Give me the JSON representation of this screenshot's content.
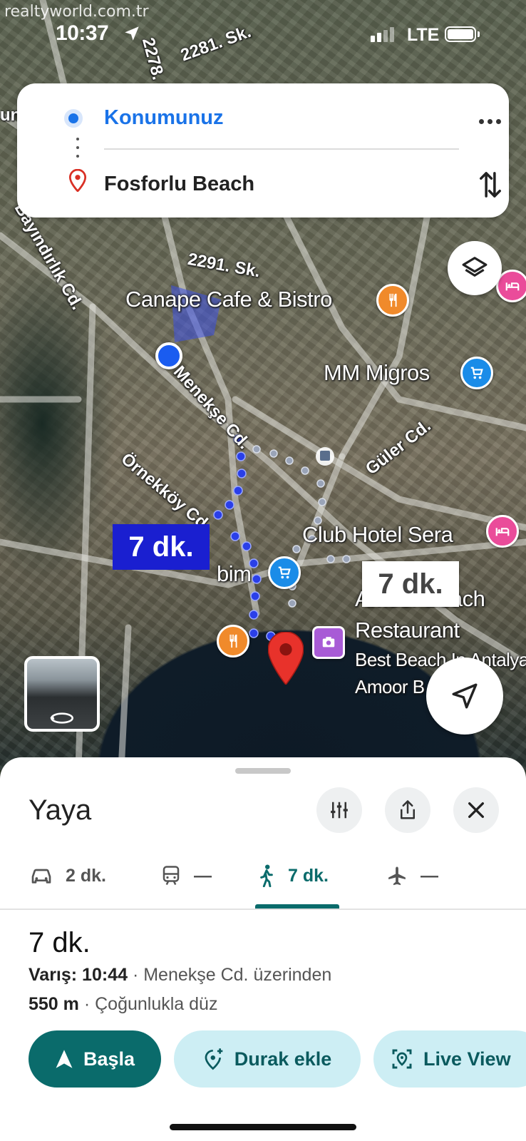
{
  "watermark": "realtyworld.com.tr",
  "status_bar": {
    "time": "10:37",
    "network": "LTE"
  },
  "directions": {
    "origin": "Konumunuz",
    "destination": "Fosforlu Beach"
  },
  "map": {
    "streets": [
      "2278. Sk.",
      "2281. Sk.",
      "2291. Sk.",
      "Bayındırlık Cd.",
      "Menekşe Cd.",
      "Örnekköy Cd.",
      "Güler Cd."
    ],
    "poi": {
      "canape": "Canape Cafe & Bistro",
      "migros": "MM Migros",
      "club_hotel": "Club Hotel Sera",
      "bim": "bim",
      "amoor_title_1": "Amoor Beach",
      "amoor_title_2": "Restaurant",
      "best_beach": "Best Beach In Antalya",
      "amoor_short": "Amoor B"
    },
    "route_time": "7 dk.",
    "alt_route_time": "7 dk.",
    "left_edge_label": "un"
  },
  "sheet": {
    "title": "Yaya",
    "modes": [
      {
        "name": "car",
        "label": "2 dk."
      },
      {
        "name": "transit",
        "label": "—"
      },
      {
        "name": "walk",
        "label": "7 dk.",
        "active": true
      },
      {
        "name": "flight",
        "label": "—"
      }
    ],
    "duration": "7 dk.",
    "arrival_label": "Varış: 10:44",
    "arrival_via": " · Menekşe Cd. üzerinden",
    "distance_label": "550 m",
    "distance_desc": " · Çoğunlukla düz",
    "actions": {
      "start": "Başla",
      "add_stop": "Durak ekle",
      "live_view": "Live View"
    }
  },
  "colors": {
    "accent_teal": "#0a6b6b",
    "route_blue": "#1a1fd0",
    "origin_blue": "#1a73e8",
    "secondary_btn_bg": "#cdeef4"
  }
}
